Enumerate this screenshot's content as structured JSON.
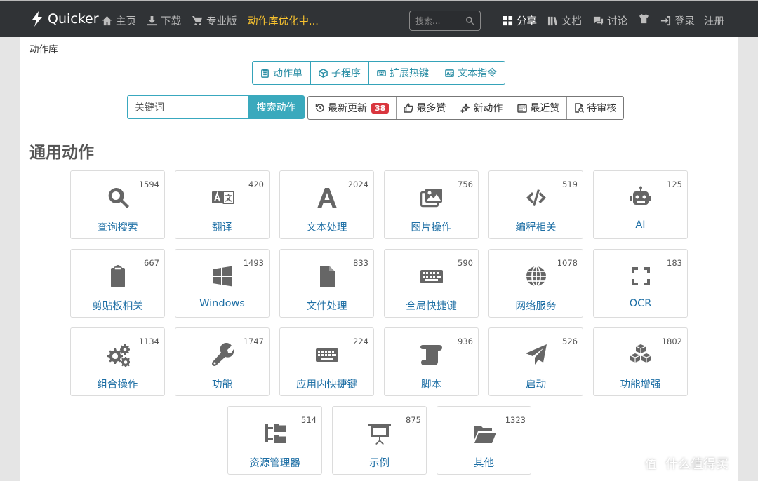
{
  "nav": {
    "brand": "Quicker",
    "items": [
      {
        "label": "主页",
        "icon": "home-icon"
      },
      {
        "label": "下载",
        "icon": "download-icon"
      },
      {
        "label": "专业版",
        "icon": "cart-icon"
      },
      {
        "label": "动作库优化中..."
      }
    ],
    "search_placeholder": "搜索...",
    "right": [
      {
        "label": "分享",
        "icon": "grid-icon"
      },
      {
        "label": "文档",
        "icon": "books-icon"
      },
      {
        "label": "讨论",
        "icon": "comments-icon"
      },
      {
        "label": "",
        "icon": "shirt-icon"
      },
      {
        "label": "登录",
        "icon": "login-icon"
      },
      {
        "label": "注册"
      }
    ]
  },
  "breadcrumb": "动作库",
  "tabs": [
    {
      "label": "动作单",
      "icon": "clipboard-icon"
    },
    {
      "label": "子程序",
      "icon": "cube-icon"
    },
    {
      "label": "扩展热键",
      "icon": "keyboard-icon"
    },
    {
      "label": "文本指令",
      "icon": "ad-icon"
    }
  ],
  "keyword": {
    "placeholder": "关键词",
    "button": "搜索动作"
  },
  "filters": [
    {
      "label": "最新更新",
      "badge": "38",
      "icon": "history-icon"
    },
    {
      "label": "最多赞",
      "icon": "thumbs-up-icon"
    },
    {
      "label": "新动作",
      "icon": "sparkle-icon"
    },
    {
      "label": "最近赞",
      "icon": "calendar-icon"
    },
    {
      "label": "待审核",
      "icon": "search-doc-icon"
    }
  ],
  "section_title": "通用动作",
  "categories": [
    {
      "label": "查询搜索",
      "count": "1594",
      "icon": "search-icon"
    },
    {
      "label": "翻译",
      "count": "420",
      "icon": "translate-icon"
    },
    {
      "label": "文本处理",
      "count": "2024",
      "icon": "font-icon"
    },
    {
      "label": "图片操作",
      "count": "756",
      "icon": "images-icon"
    },
    {
      "label": "编程相关",
      "count": "519",
      "icon": "code-icon"
    },
    {
      "label": "AI",
      "count": "125",
      "icon": "robot-icon"
    },
    {
      "label": "剪贴板相关",
      "count": "667",
      "icon": "clipboard-icon"
    },
    {
      "label": "Windows",
      "count": "1493",
      "icon": "windows-icon"
    },
    {
      "label": "文件处理",
      "count": "833",
      "icon": "file-icon"
    },
    {
      "label": "全局快捷键",
      "count": "590",
      "icon": "keyboard-icon"
    },
    {
      "label": "网络服务",
      "count": "1078",
      "icon": "globe-icon"
    },
    {
      "label": "OCR",
      "count": "183",
      "icon": "expand-icon"
    },
    {
      "label": "组合操作",
      "count": "1134",
      "icon": "gears-icon"
    },
    {
      "label": "功能",
      "count": "1747",
      "icon": "wrench-icon"
    },
    {
      "label": "应用内快捷键",
      "count": "224",
      "icon": "keyboard-icon"
    },
    {
      "label": "脚本",
      "count": "936",
      "icon": "scroll-icon"
    },
    {
      "label": "启动",
      "count": "526",
      "icon": "paper-plane-icon"
    },
    {
      "label": "功能增强",
      "count": "1802",
      "icon": "cubes-icon"
    },
    {
      "label": "资源管理器",
      "count": "514",
      "icon": "folder-tree-icon"
    },
    {
      "label": "示例",
      "count": "875",
      "icon": "presentation-icon"
    },
    {
      "label": "其他",
      "count": "1323",
      "icon": "folder-open-icon"
    }
  ],
  "watermark": "什么值得买",
  "watermark_logo": "值"
}
